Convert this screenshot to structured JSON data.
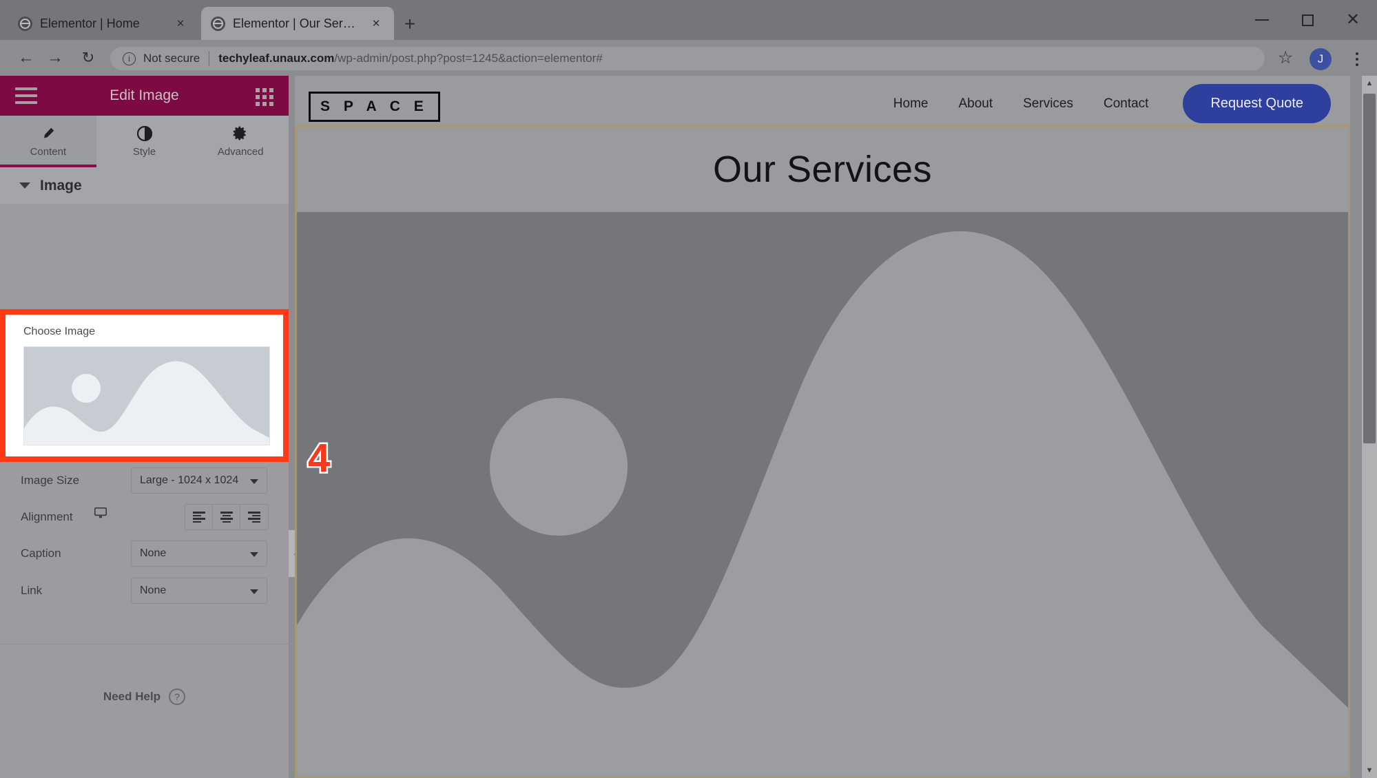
{
  "browser": {
    "tabs": [
      {
        "title": "Elementor | Home",
        "active": false,
        "close_label": "×",
        "favicon": "globe-icon"
      },
      {
        "title": "Elementor | Our Services",
        "active": true,
        "close_label": "×",
        "favicon": "globe-icon"
      }
    ],
    "new_tab_label": "+",
    "window_controls": {
      "minimize": "minimize-icon",
      "maximize": "maximize-icon",
      "close": "close-icon"
    },
    "nav": {
      "back": "←",
      "forward": "→",
      "reload": "↻"
    },
    "omnibox": {
      "info_icon_label": "i",
      "security_text": "Not secure",
      "url_scheme_host": "techyleaf.unaux.com",
      "url_path": "/wp-admin/post.php?post=1245&action=elementor#",
      "full_url": "techyleaf.unaux.com/wp-admin/post.php?post=1245&action=elementor#"
    },
    "bookmark_star": "☆",
    "profile_initial": "J",
    "menu": "kebab-menu-icon"
  },
  "panel": {
    "header": {
      "menu_icon": "hamburger-icon",
      "title": "Edit Image",
      "widgets_icon": "grid-icon"
    },
    "tabs": [
      {
        "label": "Content",
        "icon": "pencil-icon",
        "active": true
      },
      {
        "label": "Style",
        "icon": "contrast-icon",
        "active": false
      },
      {
        "label": "Advanced",
        "icon": "gear-icon",
        "active": false
      }
    ],
    "section": {
      "label": "Image",
      "caret": "caret-down-icon",
      "expanded": true
    },
    "choose_image": {
      "label": "Choose Image",
      "preview_alt": "image-placeholder-landscape",
      "highlighted": true,
      "highlight_color": "#ff3b17"
    },
    "fields": [
      {
        "label": "Image Size",
        "value": "Large - 1024 x 1024",
        "type": "select"
      },
      {
        "label": "Alignment",
        "value": "",
        "type": "button-group",
        "device_icon": "desktop-icon",
        "options": [
          "align-left",
          "align-center",
          "align-right"
        ]
      },
      {
        "label": "Caption",
        "value": "None",
        "type": "select"
      },
      {
        "label": "Link",
        "value": "None",
        "type": "select"
      }
    ],
    "need_help": {
      "text": "Need Help",
      "icon": "question-circle-icon"
    },
    "collapse_handle": "‹"
  },
  "canvas": {
    "site_header": {
      "logo": "S P A C E",
      "nav_links": [
        "Home",
        "About",
        "Services",
        "Contact"
      ],
      "cta": {
        "label": "Request Quote",
        "color": "#2f3f9e"
      }
    },
    "page_title": "Our Services",
    "hero_image_alt": "image-placeholder-landscape",
    "section_border_color": "#a79775"
  },
  "annotations": {
    "step_number": "4",
    "step_color": "#f5391a"
  },
  "scrollbar": {
    "up": "▲",
    "down": "▼"
  }
}
